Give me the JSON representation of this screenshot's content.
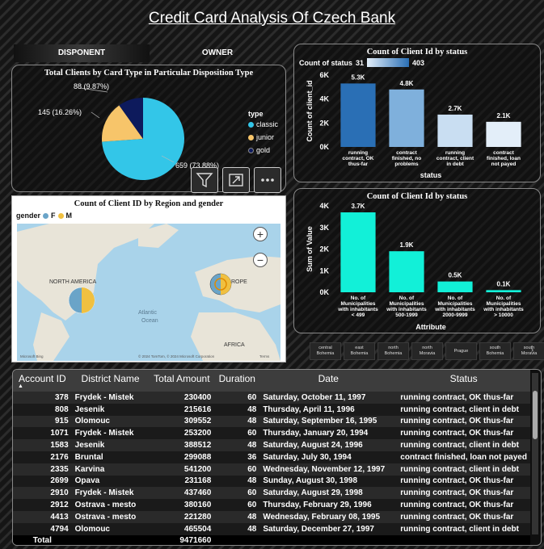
{
  "title": "Credit Card Analysis Of Czech Bank",
  "tabs": [
    "DISPONENT",
    "OWNER"
  ],
  "pie_panel": {
    "title": "Total Clients by Card Type in Particular Disposition Type",
    "labels": {
      "gold": "88 (9.87%)",
      "junior": "145 (16.26%)",
      "classic": "659 (73.88%)"
    },
    "legend_title": "type",
    "legend": [
      {
        "name": "classic",
        "color": "#33c6e8"
      },
      {
        "name": "junior",
        "color": "#f7c56a"
      },
      {
        "name": "gold",
        "color": "#0d1a5c"
      }
    ]
  },
  "map_panel": {
    "title": "Count of Client ID by Region and gender",
    "legend_title": "gender",
    "legend": [
      {
        "name": "F",
        "color": "#6aa4c8"
      },
      {
        "name": "M",
        "color": "#f0c040"
      }
    ],
    "labels": {
      "na": "NORTH AMERICA",
      "eu": "ROPE",
      "africa": "AFRICA",
      "ocean": "Atlantic Ocean",
      "ocean1": "Atlantic",
      "ocean2": "Ocean"
    },
    "credit": "© 2024 TomTom, © 2024 Microsoft Corporation",
    "terms": "Terms",
    "logo": "Microsoft Bing",
    "zoom_in": "+",
    "zoom_out": "−"
  },
  "status_panel1": {
    "title": "Count of Client Id by status",
    "gradient_label": "Count of status",
    "gradient_min": "31",
    "gradient_max": "403"
  },
  "status_panel2": {
    "title": "Count of Client Id by status"
  },
  "chart_data": [
    {
      "type": "pie",
      "title": "Total Clients by Card Type in Particular Disposition Type",
      "categories": [
        "classic",
        "junior",
        "gold"
      ],
      "values": [
        659,
        145,
        88
      ],
      "percent": [
        73.88,
        16.26,
        9.87
      ]
    },
    {
      "type": "bar",
      "title": "Count of Client Id by status",
      "xlabel": "status",
      "ylabel": "Count of client_id",
      "ylim": [
        0,
        6000
      ],
      "yticks": [
        "0K",
        "2K",
        "4K",
        "6K"
      ],
      "categories": [
        "running contract, OK thus-far",
        "contract finished, no problems",
        "running contract, client in debt",
        "contract finished, loan not payed"
      ],
      "category_lines": [
        [
          "running",
          "contract, OK",
          "thus-far"
        ],
        [
          "contract",
          "finished, no",
          "problems"
        ],
        [
          "running",
          "contract, client",
          "in debt"
        ],
        [
          "contract",
          "finished, loan",
          "not payed"
        ]
      ],
      "values": [
        5300,
        4800,
        2700,
        2100
      ],
      "data_labels": [
        "5.3K",
        "4.8K",
        "2.7K",
        "2.1K"
      ],
      "colors": [
        "#2a6fb5",
        "#7fb0dc",
        "#c9def2",
        "#e3eef9"
      ]
    },
    {
      "type": "bar",
      "title": "Count of Client Id by status",
      "xlabel": "Attribute",
      "ylabel": "Sum of Value",
      "ylim": [
        0,
        4000
      ],
      "yticks": [
        "0K",
        "1K",
        "2K",
        "3K",
        "4K"
      ],
      "categories": [
        "No. of Municipalities with inhabitants < 499",
        "No. of Municipalities with inhabitants 500-1999",
        "No. of Municipalities with inhabitants 2000-9999",
        "No. of Municipalities with inhabitants > 10000"
      ],
      "category_lines": [
        [
          "No. of",
          "Municipalities",
          "with inhabitants",
          "< 499"
        ],
        [
          "No. of",
          "Municipalities",
          "with inhabitants",
          "500-1999"
        ],
        [
          "No. of",
          "Municipalities",
          "with inhabitants",
          "2000-9999"
        ],
        [
          "No. of",
          "Municipalities",
          "with inhabitants",
          "> 10000"
        ]
      ],
      "values": [
        3700,
        1900,
        500,
        100
      ],
      "data_labels": [
        "3.7K",
        "1.9K",
        "0.5K",
        "0.1K"
      ],
      "colors": [
        "#12f0d8",
        "#12f0d8",
        "#12f0d8",
        "#12f0d8"
      ]
    }
  ],
  "slicers": [
    [
      "central",
      "Bohemia"
    ],
    [
      "east",
      "Bohemia"
    ],
    [
      "north",
      "Bohemia"
    ],
    [
      "north",
      "Moravia"
    ],
    [
      "Prague"
    ],
    [
      "south",
      "Bohemia"
    ],
    [
      "south",
      "Moravia"
    ]
  ],
  "slicer_next": "›",
  "table": {
    "headers": [
      "Account ID",
      "District Name",
      "Total Amount",
      "Duration",
      "Date",
      "Status"
    ],
    "rows": [
      [
        "378",
        "Frydek - Mistek",
        "230400",
        "60",
        "Saturday, October 11, 1997",
        "running contract, OK thus-far"
      ],
      [
        "808",
        "Jesenik",
        "215616",
        "48",
        "Thursday, April 11, 1996",
        "running contract, client in debt"
      ],
      [
        "915",
        "Olomouc",
        "309552",
        "48",
        "Saturday, September 16, 1995",
        "running contract, OK thus-far"
      ],
      [
        "1071",
        "Frydek - Mistek",
        "253200",
        "60",
        "Thursday, January 20, 1994",
        "running contract, OK thus-far"
      ],
      [
        "1583",
        "Jesenik",
        "388512",
        "48",
        "Saturday, August 24, 1996",
        "running contract, client in debt"
      ],
      [
        "2176",
        "Bruntal",
        "299088",
        "36",
        "Saturday, July 30, 1994",
        "contract finished, loan not payed"
      ],
      [
        "2335",
        "Karvina",
        "541200",
        "60",
        "Wednesday, November 12, 1997",
        "running contract, client in debt"
      ],
      [
        "2699",
        "Opava",
        "231168",
        "48",
        "Sunday, August 30, 1998",
        "running contract, OK thus-far"
      ],
      [
        "2910",
        "Frydek - Mistek",
        "437460",
        "60",
        "Saturday, August 29, 1998",
        "running contract, OK thus-far"
      ],
      [
        "2912",
        "Ostrava - mesto",
        "380160",
        "60",
        "Thursday, February 29, 1996",
        "running contract, OK thus-far"
      ],
      [
        "4413",
        "Ostrava - mesto",
        "221280",
        "48",
        "Wednesday, February 08, 1995",
        "running contract, OK thus-far"
      ],
      [
        "4794",
        "Olomouc",
        "465504",
        "48",
        "Saturday, December 27, 1997",
        "running contract, client in debt"
      ]
    ],
    "total_label": "Total",
    "total_amount": "9471660"
  }
}
